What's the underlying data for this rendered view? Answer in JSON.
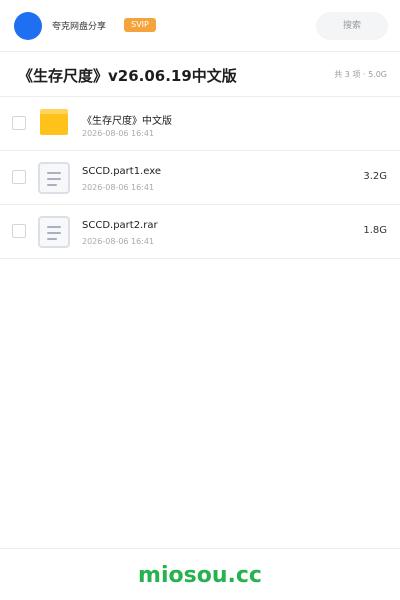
{
  "header": {
    "app_name": "夸克网盘分享",
    "badge": "SVIP",
    "search_placeholder": "搜索",
    "avatar_color": "#1e6ff1"
  },
  "share": {
    "title": "《生存尺度》v26.06.19中文版",
    "meta": "共 3 项 · 5.0G"
  },
  "files": [
    {
      "icon": "folder-icon",
      "name": "《生存尺度》中文版",
      "date": "2026-08-06 16:41",
      "size": ""
    },
    {
      "icon": "document-icon",
      "name": "SCCD.part1.exe",
      "date": "2026-08-06 16:41",
      "size": "3.2G"
    },
    {
      "icon": "document-icon",
      "name": "SCCD.part2.rar",
      "date": "2026-08-06 16:41",
      "size": "1.8G"
    }
  ],
  "footer": {
    "watermark": "miosou.cc",
    "watermark_color": "#26b24e"
  }
}
